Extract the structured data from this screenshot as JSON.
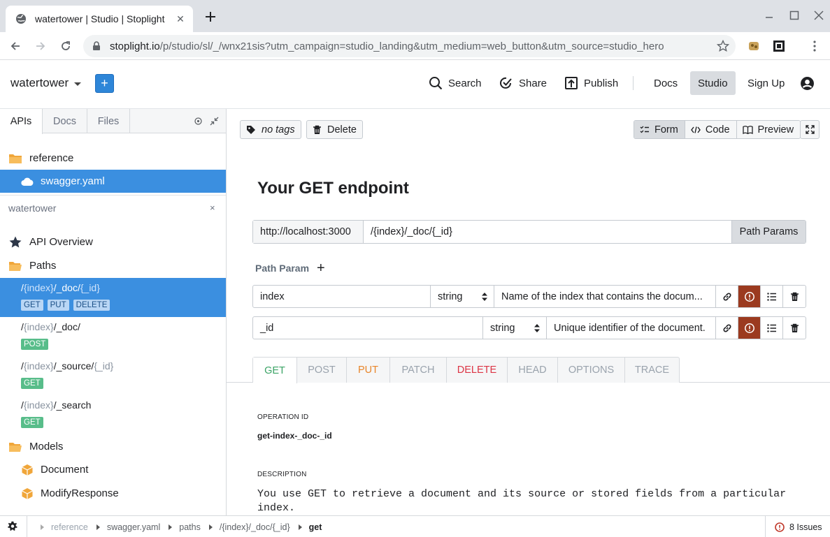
{
  "browser": {
    "tab_title": "watertower | Studio | Stoplight",
    "url_host": "stoplight.io",
    "url_rest": "/p/studio/sl/_/wnx21sis?utm_campaign=studio_landing&utm_medium=web_button&utm_source=studio_hero"
  },
  "header": {
    "project_name": "watertower",
    "add_label": "+",
    "search_label": "Search",
    "share_label": "Share",
    "publish_label": "Publish",
    "docs_label": "Docs",
    "studio_label": "Studio",
    "signup_label": "Sign Up"
  },
  "sidebar": {
    "tabs": [
      "APIs",
      "Docs",
      "Files"
    ],
    "files": [
      {
        "label": "reference",
        "icon": "folder-icon"
      },
      {
        "label": "swagger.yaml",
        "icon": "cloud-icon"
      }
    ],
    "workspace_label": "watertower",
    "workspace_close": "×",
    "api_overview": "API Overview",
    "paths_label": "Paths",
    "paths": [
      {
        "prefix": "/",
        "p1": "{index}",
        "mid": "/_doc/",
        "p2": "{_id}",
        "methods": [
          "GET",
          "PUT",
          "DELETE"
        ]
      },
      {
        "prefix": "/",
        "p1": "{index}",
        "mid": "/_doc/",
        "p2": "",
        "methods": [
          "POST"
        ]
      },
      {
        "prefix": "/",
        "p1": "{index}",
        "mid": "/_source/",
        "p2": "{_id}",
        "methods": [
          "GET"
        ]
      },
      {
        "prefix": "/",
        "p1": "{index}",
        "mid": "/_search",
        "p2": "",
        "methods": [
          "GET"
        ]
      }
    ],
    "models_label": "Models",
    "models": [
      "Document",
      "ModifyResponse"
    ]
  },
  "main": {
    "tags_label": "no tags",
    "delete_label": "Delete",
    "view_modes": [
      "Form",
      "Code",
      "Preview"
    ],
    "endpoint_title": "Your GET endpoint",
    "server": "http://localhost:3000",
    "path": "/{index}/_doc/{_id}",
    "path_params_btn": "Path Params",
    "path_param_label": "Path Param",
    "path_param_add": "+",
    "params": [
      {
        "name": "index",
        "type": "string",
        "description": "Name of the index that contains the docum..."
      },
      {
        "name": "_id",
        "type": "string",
        "description": "Unique identifier of the document."
      }
    ],
    "verbs": [
      {
        "label": "GET",
        "color": "#3ba466"
      },
      {
        "label": "POST",
        "color": "#9aa3ad"
      },
      {
        "label": "PUT",
        "color": "#e8862b"
      },
      {
        "label": "PATCH",
        "color": "#9aa3ad"
      },
      {
        "label": "DELETE",
        "color": "#dc3545"
      },
      {
        "label": "HEAD",
        "color": "#9aa3ad"
      },
      {
        "label": "OPTIONS",
        "color": "#9aa3ad"
      },
      {
        "label": "TRACE",
        "color": "#9aa3ad"
      }
    ],
    "operation_id_label": "OPERATION ID",
    "operation_id": "get-index-_doc-_id",
    "description_label": "DESCRIPTION",
    "description": "You use GET to retrieve a document and its source or stored fields from a particular index."
  },
  "footer": {
    "breadcrumbs": [
      "reference",
      "swagger.yaml",
      "paths",
      "/{index}/_doc/{_id}",
      "get"
    ],
    "issues": "8 Issues"
  }
}
